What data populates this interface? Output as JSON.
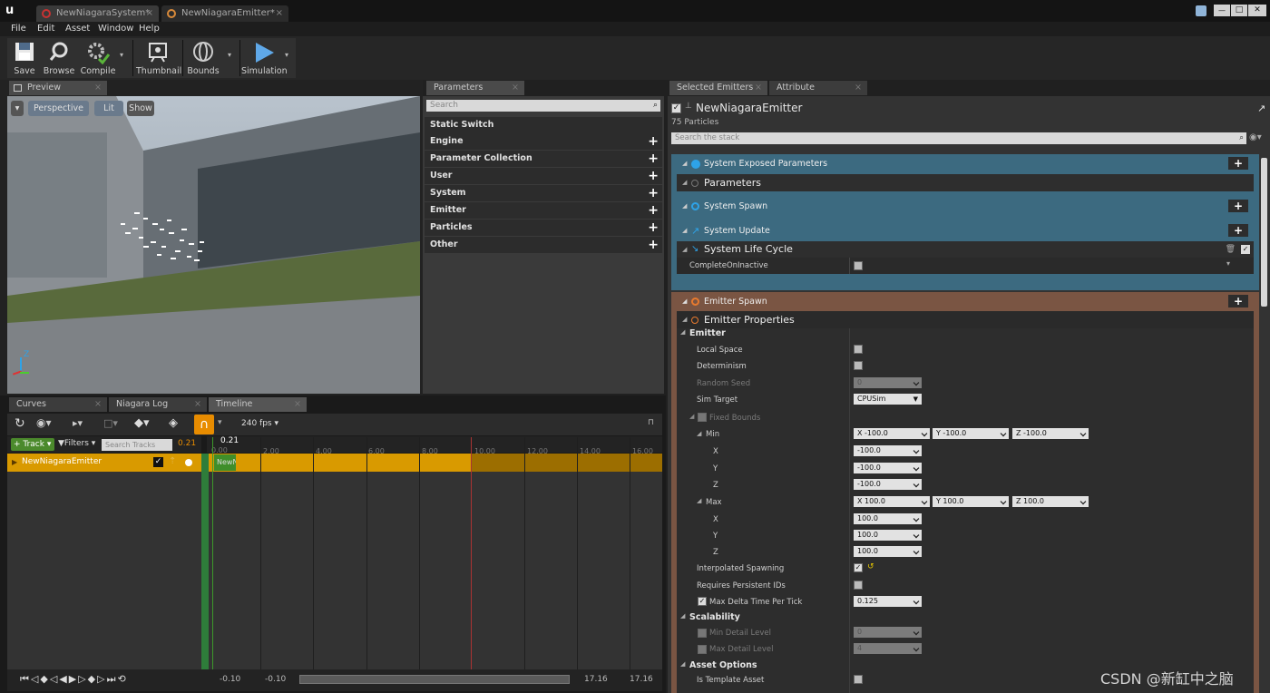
{
  "titlebar": {
    "tabs": [
      {
        "label": "NewNiagaraSystem*"
      },
      {
        "label": "NewNiagaraEmitter*"
      }
    ],
    "win_min": "—",
    "win_max": "□",
    "win_close": "✕"
  },
  "menu": [
    "File",
    "Edit",
    "Asset",
    "Window",
    "Help"
  ],
  "toolbar": {
    "save": "Save",
    "browse": "Browse",
    "compile": "Compile",
    "thumbnail": "Thumbnail",
    "bounds": "Bounds",
    "simulation": "Simulation"
  },
  "preview": {
    "tab": "Preview",
    "perspective": "Perspective",
    "lit": "Lit",
    "show": "Show",
    "axis_z": "Z"
  },
  "parameters": {
    "tab": "Parameters",
    "search_placeholder": "Search",
    "items": [
      "Static Switch",
      "Engine",
      "Parameter Collection",
      "User",
      "System",
      "Emitter",
      "Particles",
      "Other"
    ]
  },
  "bottom_tabs": {
    "curves": "Curves",
    "log": "Niagara Log",
    "timeline": "Timeline"
  },
  "timeline": {
    "fps": "240 fps",
    "track_btn": "Track",
    "filters_btn": "Filters",
    "search_tracks": "Search Tracks",
    "current_time": "0.21",
    "track_name": "NewNiagaraEmitter",
    "clip_label": "NewN",
    "ticks": [
      "0.00",
      "2.00",
      "4.00",
      "6.00",
      "8.00",
      "10.00",
      "12.00",
      "14.00",
      "16.00"
    ],
    "range_start_a": "-0.10",
    "range_start_b": "-0.10",
    "range_end_a": "17.16",
    "range_end_b": "17.16"
  },
  "right_tabs": {
    "selected": "Selected Emitters",
    "spreadsheet": "Attribute Spreadsheet"
  },
  "emitter": {
    "name": "NewNiagaraEmitter",
    "particles": "75 Particles",
    "search_placeholder": "Search the stack"
  },
  "stack": {
    "system_exposed": "System Exposed Parameters",
    "parameters": "Parameters",
    "system_spawn": "System Spawn",
    "system_update": "System Update",
    "system_life_cycle": "System Life Cycle",
    "complete_on_inactive": "CompleteOnInactive",
    "emitter_spawn": "Emitter Spawn",
    "emitter_properties": "Emitter Properties",
    "emitter_cat": "Emitter",
    "local_space": "Local Space",
    "determinism": "Determinism",
    "random_seed": "Random Seed",
    "random_seed_val": "0",
    "sim_target": "Sim Target",
    "sim_target_val": "CPUSim",
    "fixed_bounds": "Fixed Bounds",
    "min": "Min",
    "max": "Max",
    "x": "X",
    "y": "Y",
    "z": "Z",
    "min_x": "X  -100.0",
    "min_y": "Y  -100.0",
    "min_z": "Z  -100.0",
    "min_x_val": "-100.0",
    "min_y_val": "-100.0",
    "min_z_val": "-100.0",
    "max_x": "X  100.0",
    "max_y": "Y  100.0",
    "max_z": "Z  100.0",
    "max_x_val": "100.0",
    "max_y_val": "100.0",
    "max_z_val": "100.0",
    "interp": "Interpolated Spawning",
    "persistent": "Requires Persistent IDs",
    "max_delta": "Max Delta Time Per Tick",
    "max_delta_val": "0.125",
    "scalability": "Scalability",
    "min_detail": "Min Detail Level",
    "min_detail_val": "0",
    "max_detail": "Max Detail Level",
    "max_detail_val": "4",
    "asset_options": "Asset Options",
    "template": "Is Template Asset"
  },
  "watermark": "CSDN @新缸中之脑",
  "colors": {
    "system": "#3c6a80",
    "emitter": "#7a5543",
    "timeline_track": "#d99a00"
  }
}
